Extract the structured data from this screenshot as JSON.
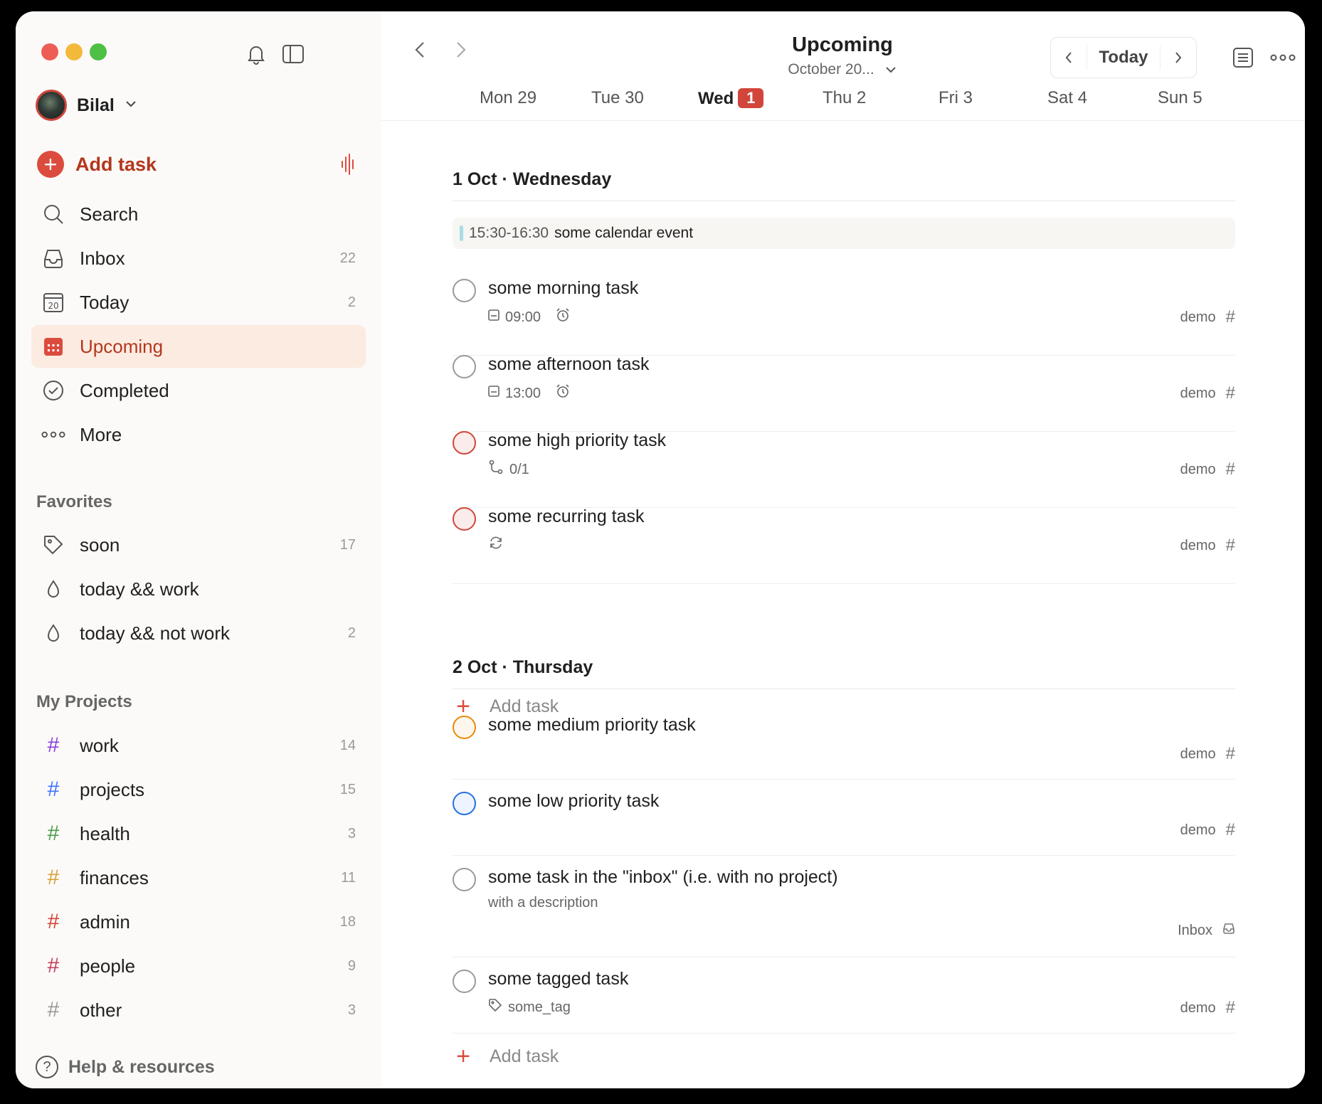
{
  "colors": {
    "accent": "#dc4c3e",
    "accent_text": "#b3371d",
    "active_bg": "#fcebe1",
    "sidebar_bg": "#fcfaf8"
  },
  "sidebar": {
    "user_name": "Bilal",
    "add_task_label": "Add task",
    "nav": [
      {
        "label": "Search",
        "icon": "search-icon",
        "count": ""
      },
      {
        "label": "Inbox",
        "icon": "inbox-icon",
        "count": "22"
      },
      {
        "label": "Today",
        "icon": "calendar-today-icon",
        "count": "2"
      },
      {
        "label": "Upcoming",
        "icon": "calendar-grid-icon",
        "count": ""
      },
      {
        "label": "Completed",
        "icon": "check-circle-icon",
        "count": ""
      },
      {
        "label": "More",
        "icon": "more-dots-icon",
        "count": ""
      }
    ],
    "favorites_title": "Favorites",
    "favorites": [
      {
        "label": "soon",
        "icon": "tag-icon",
        "count": "17"
      },
      {
        "label": "today && work",
        "icon": "filter-drop-icon",
        "count": ""
      },
      {
        "label": "today && not work",
        "icon": "filter-drop-icon",
        "count": "2"
      }
    ],
    "projects_title": "My Projects",
    "projects": [
      {
        "label": "work",
        "color": "#8c40d9",
        "count": "14"
      },
      {
        "label": "projects",
        "color": "#4073ff",
        "count": "15"
      },
      {
        "label": "health",
        "color": "#4c9c4a",
        "count": "3"
      },
      {
        "label": "finances",
        "color": "#d6a23b",
        "count": "11"
      },
      {
        "label": "admin",
        "color": "#d1453b",
        "count": "18"
      },
      {
        "label": "people",
        "color": "#c2405e",
        "count": "9"
      },
      {
        "label": "other",
        "color": "#999999",
        "count": "3"
      }
    ],
    "help_label": "Help & resources"
  },
  "header": {
    "title": "Upcoming",
    "subtitle": "October 20...",
    "today_label": "Today"
  },
  "days": [
    {
      "label": "Mon 29",
      "badge": ""
    },
    {
      "label": "Tue 30",
      "badge": ""
    },
    {
      "label": "Wed",
      "badge": "1"
    },
    {
      "label": "Thu 2",
      "badge": ""
    },
    {
      "label": "Fri 3",
      "badge": ""
    },
    {
      "label": "Sat 4",
      "badge": ""
    },
    {
      "label": "Sun 5",
      "badge": ""
    }
  ],
  "sections": [
    {
      "title": "1 Oct · Wednesday",
      "event": {
        "time": "15:30-16:30",
        "title": "some calendar event"
      },
      "tasks": [
        {
          "title": "some morning task",
          "priority": "none",
          "meta": "09:00",
          "project": "demo"
        },
        {
          "title": "some afternoon task",
          "priority": "none",
          "meta": "13:00",
          "project": "demo"
        },
        {
          "title": "some high priority task",
          "priority": "p1",
          "meta": "0/1",
          "project": "demo"
        },
        {
          "title": "some recurring task",
          "priority": "p1",
          "meta": "",
          "project": "demo"
        }
      ],
      "add_label": "Add task"
    },
    {
      "title": "2 Oct · Thursday",
      "tasks": [
        {
          "title": "some medium priority task",
          "priority": "p2",
          "meta": "",
          "project": "demo"
        },
        {
          "title": "some low priority task",
          "priority": "p3",
          "meta": "",
          "project": "demo"
        },
        {
          "title": "some task in the \"inbox\" (i.e. with no project)",
          "priority": "none",
          "description": "with a description",
          "project": "Inbox"
        },
        {
          "title": "some tagged task",
          "priority": "none",
          "meta": "some_tag",
          "project": "demo"
        }
      ],
      "add_label": "Add task"
    }
  ]
}
